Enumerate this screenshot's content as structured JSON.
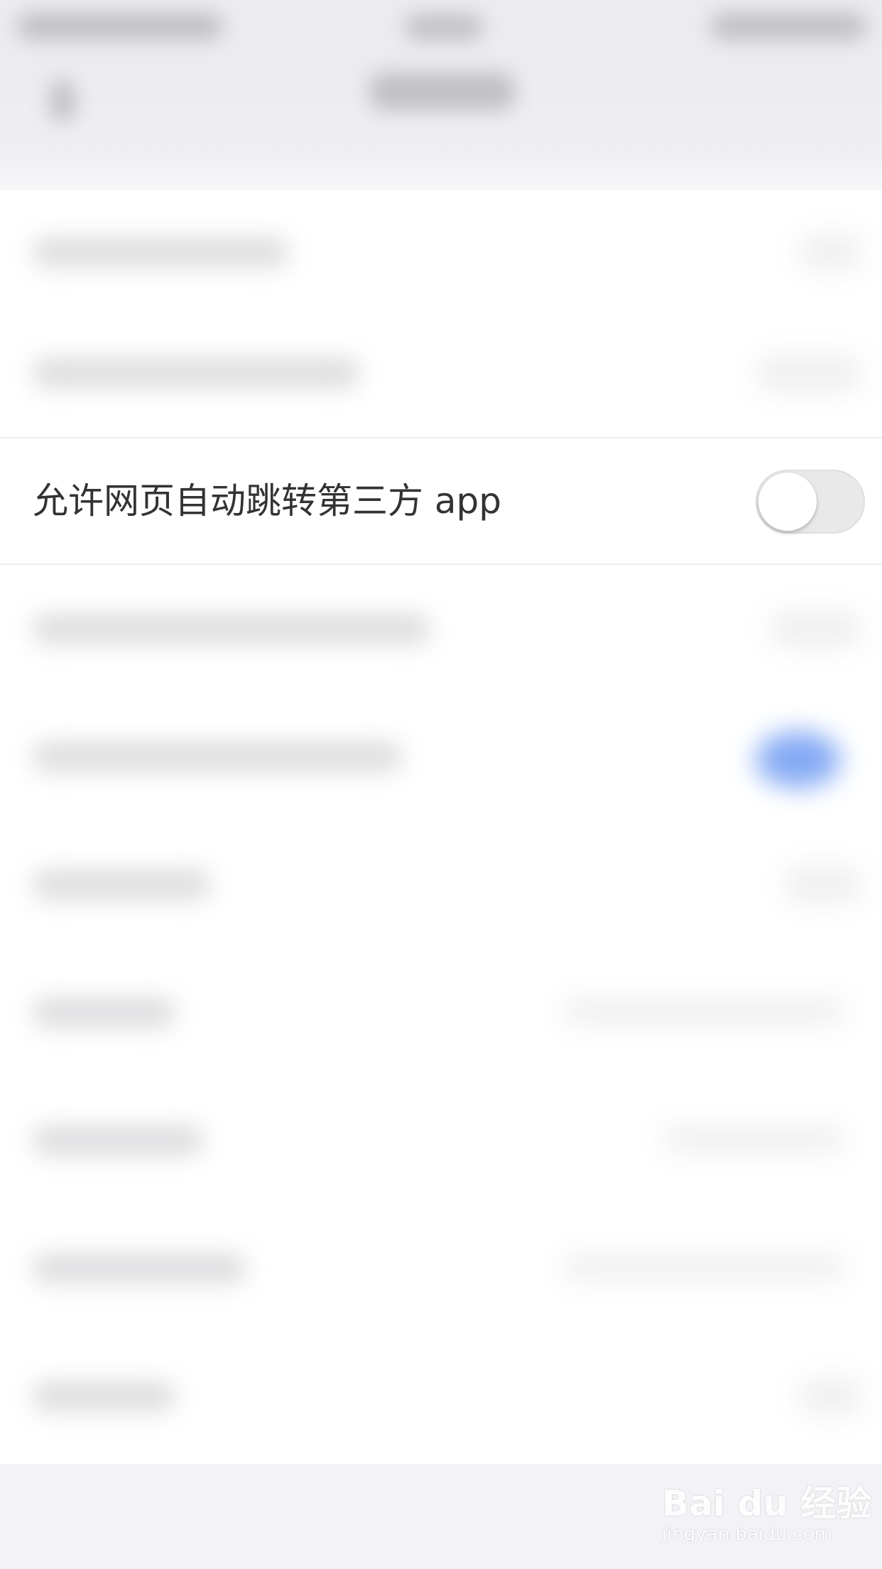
{
  "settings": {
    "visible_row": {
      "label": "允许网页自动跳转第三方 app",
      "toggle_on": false
    }
  },
  "watermark": {
    "logo_text": "Bai du 经验",
    "url_text": "jingyan.baidu.com"
  },
  "colors": {
    "toggle_off_track": "#e9e9ea",
    "toggle_on_blur": "#5b8df1",
    "text_primary": "#333333",
    "header_bg": "#ebebf0"
  }
}
